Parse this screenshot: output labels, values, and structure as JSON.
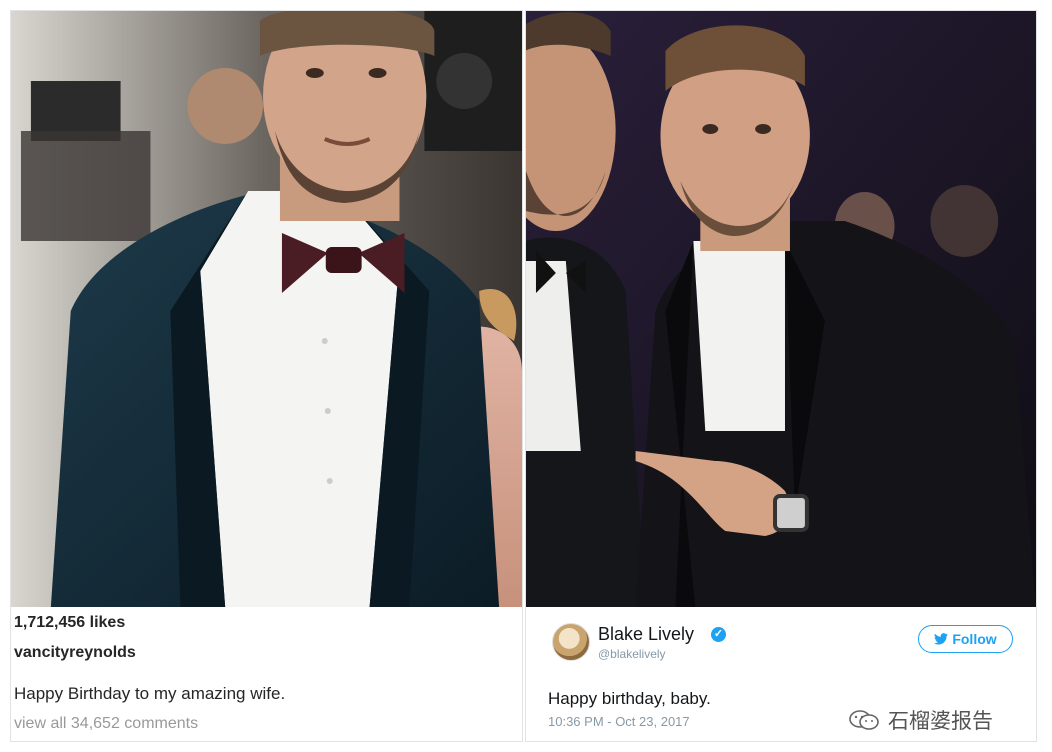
{
  "instagram": {
    "likes": "1,712,456 likes",
    "username": "vancityreynolds",
    "caption": "Happy Birthday to my amazing wife.",
    "comments": "view all 34,652 comments"
  },
  "tweet": {
    "name": "Blake Lively",
    "handle": "@blakelively",
    "follow_label": "Follow",
    "text": "Happy birthday, baby.",
    "timestamp": "10:36 PM - Oct 23, 2017"
  },
  "watermark": {
    "text": "石榴婆报告"
  },
  "colors": {
    "twitter_blue": "#1da1f2",
    "instagram_text": "#262626"
  }
}
